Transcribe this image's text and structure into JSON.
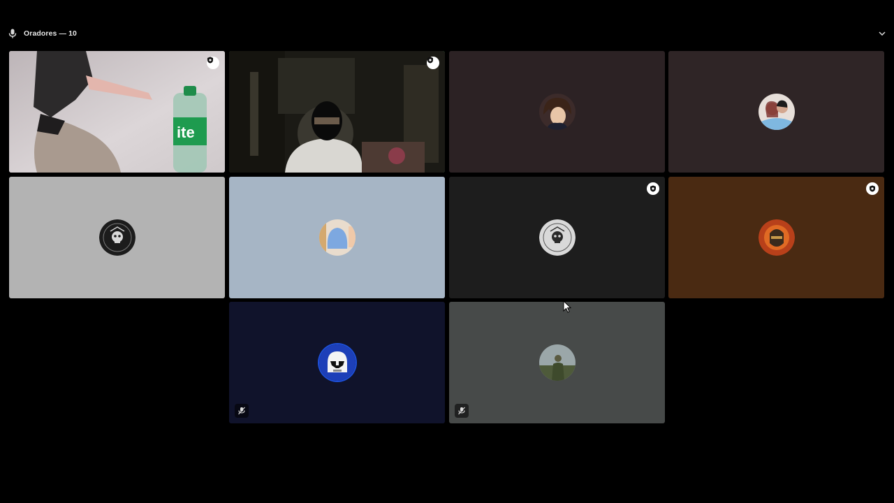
{
  "header": {
    "title": "Oradores — 10",
    "icon": "microphone-icon",
    "collapse_icon": "chevron-down-icon"
  },
  "colors": {
    "speaking_border": "#3ba55d",
    "tile_backgrounds": [
      "#2c2224",
      "#2f2526",
      "#b3b3b3",
      "#a6b5c5",
      "#1d1d1d",
      "#4a2a12",
      "#10132b",
      "#474a49"
    ]
  },
  "tiles": [
    {
      "id": 1,
      "type": "video",
      "badge": "shield-badge-icon",
      "speaking": false,
      "muted": false
    },
    {
      "id": 2,
      "type": "video",
      "badge": "shield-badge-icon",
      "speaking": true,
      "muted": false
    },
    {
      "id": 3,
      "type": "avatar",
      "avatar": "anime-character-avatar"
    },
    {
      "id": 4,
      "type": "avatar",
      "avatar": "couple-photo-avatar"
    },
    {
      "id": 5,
      "type": "avatar",
      "avatar": "clan-azteca-emblem-avatar",
      "avatar_text": "CLAN AZTECA ARMY BETO"
    },
    {
      "id": 6,
      "type": "avatar",
      "avatar": "blue-figure-avatar"
    },
    {
      "id": 7,
      "type": "avatar",
      "avatar": "clan-azteca-emblem-avatar",
      "avatar_text": "CLAN AZTECA ARMY SORA",
      "badge": "shield-badge-icon"
    },
    {
      "id": 8,
      "type": "avatar",
      "avatar": "red-flame-warrior-avatar",
      "badge": "shield-badge-icon"
    },
    {
      "id": 9,
      "type": "avatar",
      "avatar": "clone-trooper-helmet-avatar",
      "muted": true,
      "muted_icon": "muted-mic-icon"
    },
    {
      "id": 10,
      "type": "avatar",
      "avatar": "soldier-photo-avatar",
      "muted": true,
      "muted_icon": "muted-mic-icon"
    }
  ]
}
